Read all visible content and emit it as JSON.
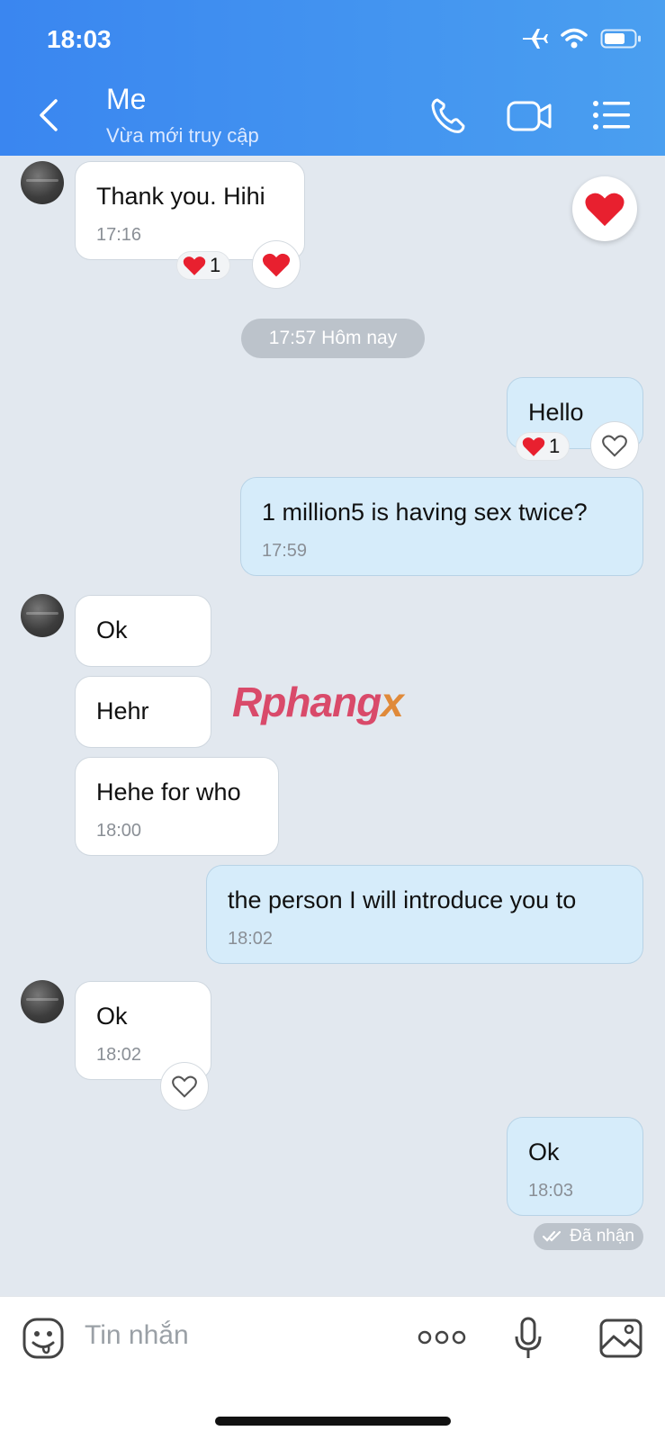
{
  "status_bar": {
    "time": "18:03"
  },
  "header": {
    "title": "Me",
    "subtitle": "Vừa mới truy cập"
  },
  "messages": [
    {
      "text": "Thank you. Hihi",
      "time": "17:16",
      "reaction_count": "1"
    },
    {
      "divider": "17:57 Hôm nay"
    },
    {
      "text": "Hello",
      "reaction_count": "1"
    },
    {
      "text": "1 million5 is having sex twice?",
      "time": "17:59"
    },
    {
      "text": "Ok"
    },
    {
      "text": "Hehr"
    },
    {
      "text": "Hehe for who",
      "time": "18:00"
    },
    {
      "text": "the person I will introduce you to",
      "time": "18:02"
    },
    {
      "text": "Ok",
      "time": "18:02"
    },
    {
      "text": "Ok",
      "time": "18:03",
      "status": "Đã nhận"
    }
  ],
  "watermark": {
    "main": "Rphang",
    "tail": "x"
  },
  "composer": {
    "placeholder": "Tin nhắn"
  },
  "colors": {
    "header_start": "#3a86f0",
    "header_end": "#4a9ff0",
    "outgoing_bubble": "#d6ecfa",
    "chat_background": "#e2e8ef",
    "heart": "#e8202f"
  }
}
